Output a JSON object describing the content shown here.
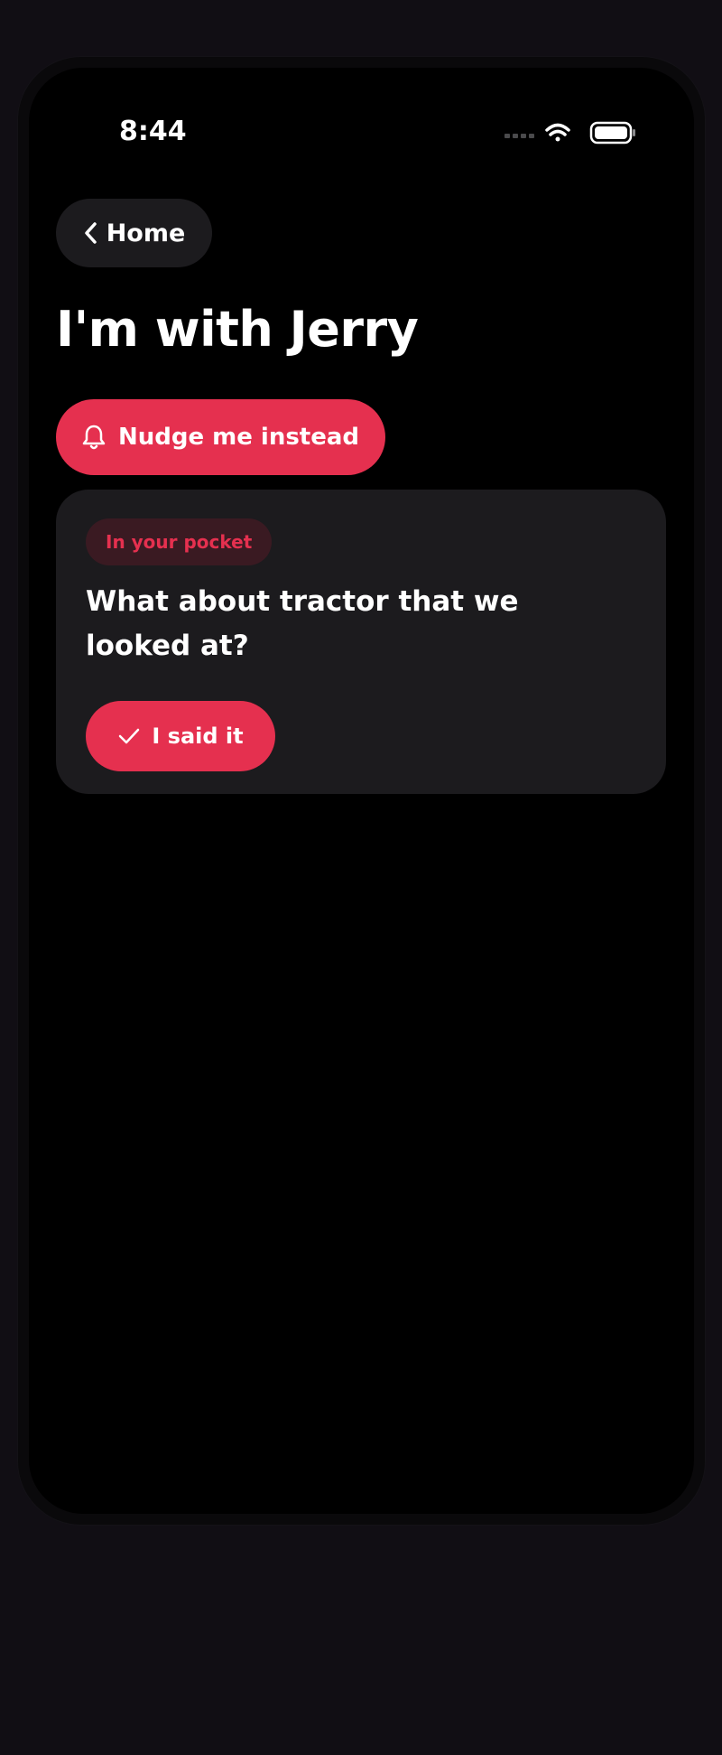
{
  "status_bar": {
    "time": "8:44",
    "icons": [
      "signal-dots-icon",
      "wifi-icon",
      "battery-icon"
    ]
  },
  "nav": {
    "back_label": "Home",
    "back_icon": "chevron-left-icon"
  },
  "page": {
    "title": "I'm with Jerry"
  },
  "nudge": {
    "label": "Nudge me instead",
    "icon": "bell-icon"
  },
  "card": {
    "badge": "In your pocket",
    "text": "What about tractor that we looked at?",
    "action_label": "I said it",
    "action_icon": "checkmark-icon"
  },
  "colors": {
    "accent": "#e5304f",
    "card_bg": "#1c1b1e",
    "badge_bg": "#3a1a22",
    "screen_bg": "#000000",
    "page_bg": "#110e14"
  }
}
